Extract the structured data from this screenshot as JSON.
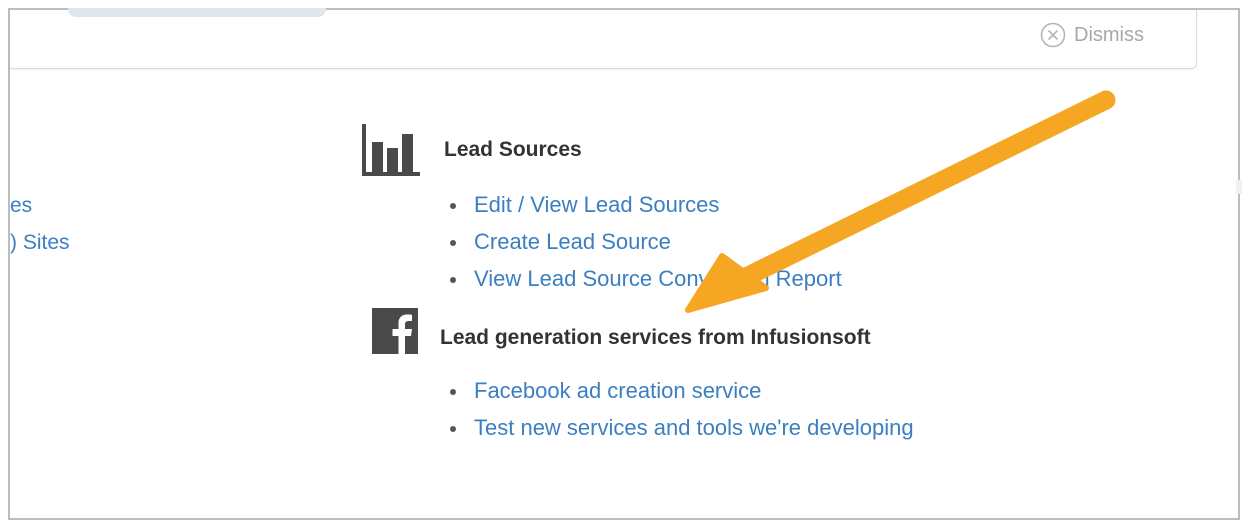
{
  "banner": {
    "dismiss_label": "Dismiss"
  },
  "left_partial_links": [
    "es",
    ") Sites"
  ],
  "lead_sources": {
    "title": "Lead Sources",
    "icon": "bar-chart-icon",
    "links": [
      "Edit / View Lead Sources",
      "Create Lead Source",
      "View Lead Source Conversion Report"
    ]
  },
  "lead_generation": {
    "title": "Lead generation services from Infusionsoft",
    "icon": "facebook-icon",
    "links": [
      "Facebook ad creation service",
      "Test new services and tools we're developing"
    ]
  },
  "colors": {
    "link": "#3b7fc2",
    "heading": "#333333",
    "annotation_arrow": "#f5a623"
  }
}
